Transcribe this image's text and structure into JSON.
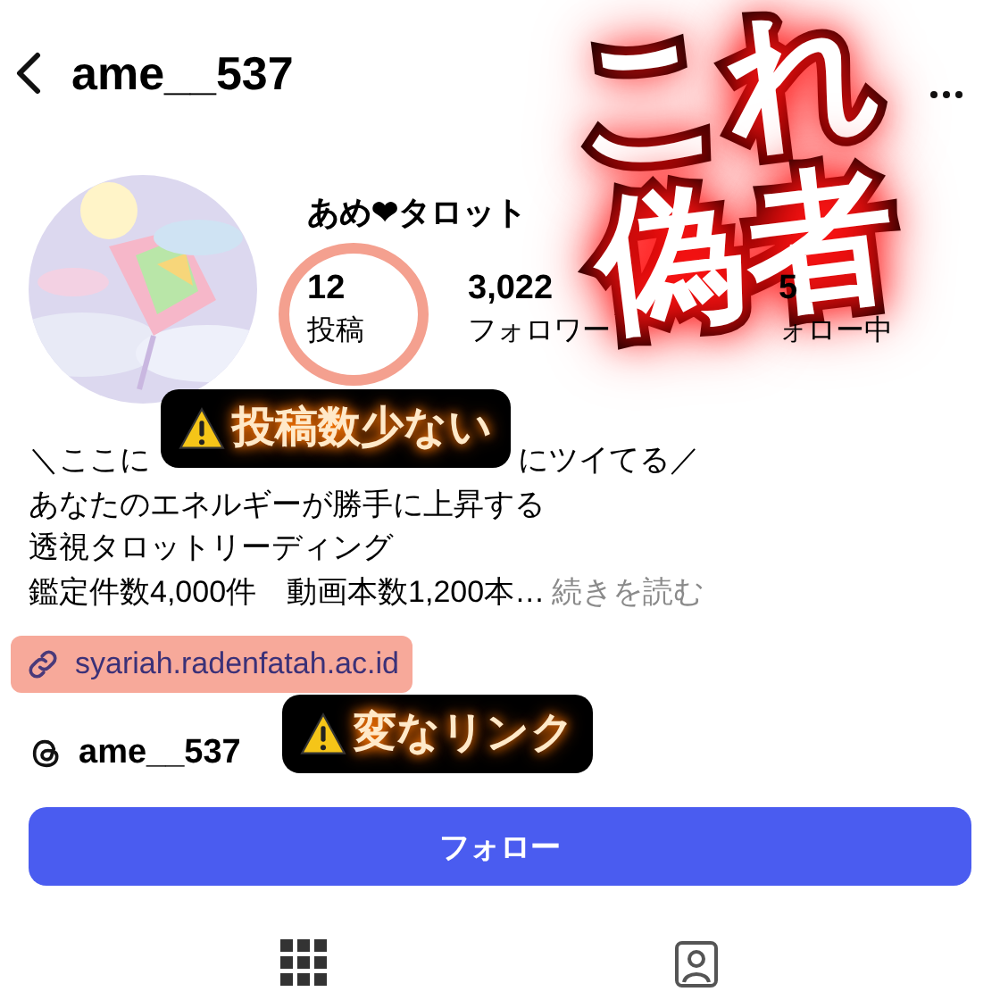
{
  "header": {
    "username": "ame__537"
  },
  "profile": {
    "display_name": "あめ❤タロット",
    "stats": [
      {
        "value": "12",
        "label": "投稿"
      },
      {
        "value": "3,022",
        "label": "フォロワー"
      },
      {
        "value": "5",
        "label": "ォロー中"
      }
    ]
  },
  "bio": {
    "first_line_parts": [
      "＼ここに",
      "にツイてる／"
    ],
    "lines": [
      "あなたのエネルギーが勝手に上昇する",
      "透視タロットリーディング",
      "鑑定件数4,000件　動画本数1,200本…"
    ],
    "more_link": "続きを読む"
  },
  "link": "syariah.radenfatah.ac.id",
  "threads": {
    "username": "ame__537"
  },
  "follow_button": "フォロー",
  "annotations": {
    "headline_lines": [
      "これ",
      "偽者"
    ],
    "callouts": [
      "投稿数少ない",
      "変なリンク"
    ]
  }
}
